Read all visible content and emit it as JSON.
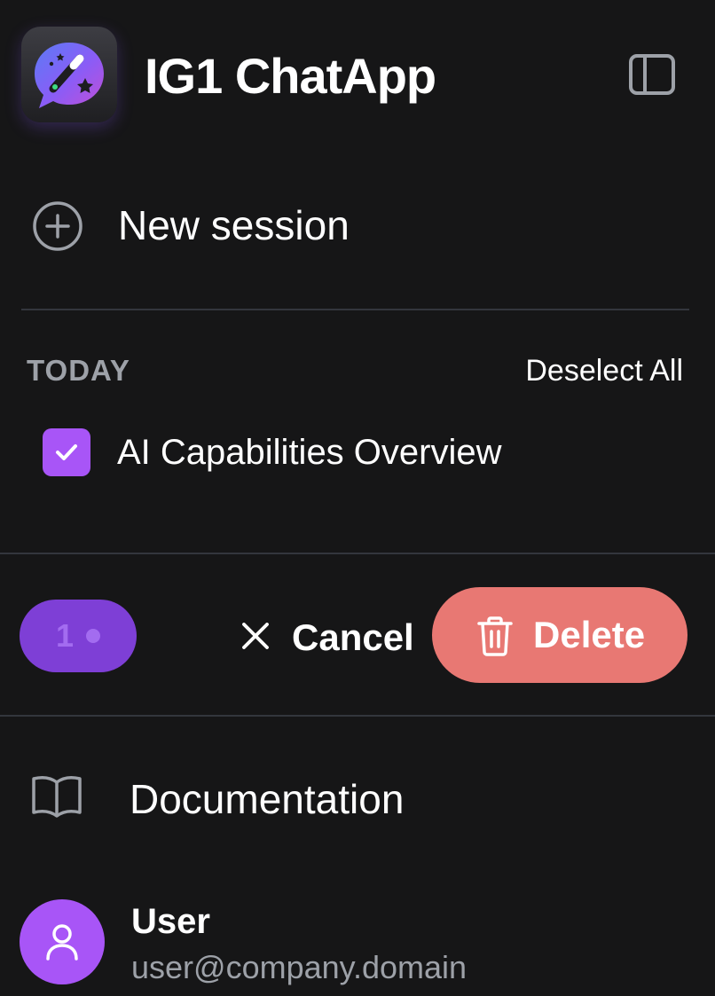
{
  "app": {
    "title": "IG1 ChatApp",
    "accent_color": "#a855f7",
    "danger_color": "#e87873"
  },
  "header": {
    "logo_icon": "chat-bubble-magic-wand-icon",
    "toggle_icon": "sidebar-panel-icon"
  },
  "new_session": {
    "label": "New session",
    "icon": "plus-circle-icon"
  },
  "history": {
    "section_title": "TODAY",
    "deselect_all_label": "Deselect All",
    "items": [
      {
        "label": "AI Capabilities Overview",
        "selected": true
      }
    ]
  },
  "selection_bar": {
    "count": "1",
    "cancel_label": "Cancel",
    "cancel_icon": "close-icon",
    "delete_label": "Delete",
    "delete_icon": "trash-icon"
  },
  "footer": {
    "docs_label": "Documentation",
    "docs_icon": "book-open-icon",
    "user": {
      "name": "User",
      "email": "user@company.domain",
      "avatar_icon": "user-icon"
    }
  }
}
